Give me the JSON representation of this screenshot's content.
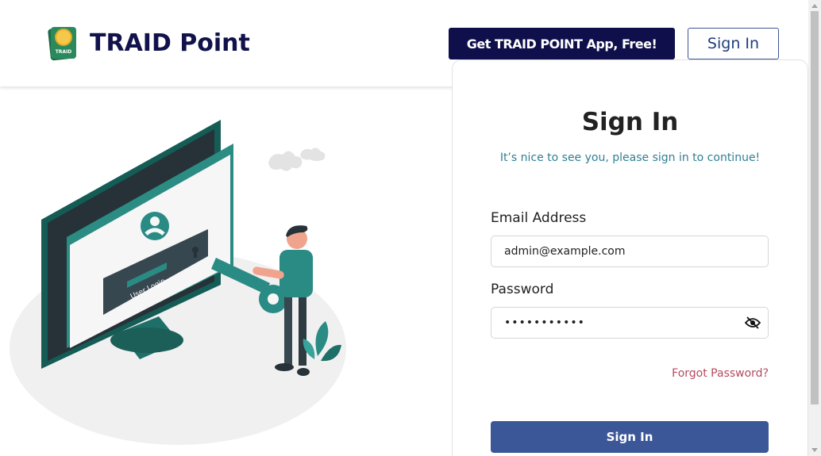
{
  "header": {
    "brand_name": "TRAID Point",
    "logo_text": "TRAID",
    "app_button_label": "Get TRAID POINT App, Free!",
    "signin_button_label": "Sign In"
  },
  "illustration": {
    "screen_label": "User Login"
  },
  "signin_card": {
    "title": "Sign In",
    "subtitle": "It’s nice to see you, please sign in to continue!",
    "email_label": "Email Address",
    "email_value": "admin@example.com",
    "password_label": "Password",
    "password_value": "•••••••••••",
    "forgot_link": "Forgot Password?",
    "submit_label": "Sign In"
  },
  "icons": {
    "password_toggle": "eye-slash-icon",
    "logo": "coin-logo-icon"
  },
  "colors": {
    "brand_navy": "#0e0f4b",
    "teal": "#1e7b74",
    "subtitle": "#2f7f93",
    "forgot": "#b34a5e",
    "submit": "#3b5797"
  }
}
